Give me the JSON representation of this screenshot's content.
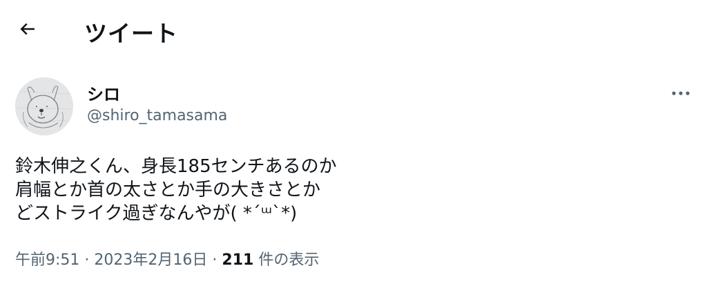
{
  "header": {
    "back_icon": "arrow-left-icon",
    "title": "ツイート"
  },
  "author": {
    "avatar_icon": "dog-sketch-avatar",
    "display_name": "シロ",
    "handle": "@shiro_tamasama"
  },
  "more_icon": "more-horizontal-icon",
  "tweet": {
    "lines": [
      "鈴木伸之くん、身長185センチあるのか",
      "肩幅とか首の太さとか手の大きさとか",
      "どストライク過ぎなんやが( *´ᵚ`*)"
    ]
  },
  "meta": {
    "time": "午前9:51",
    "separator": "·",
    "date": "2023年2月16日",
    "views_count": "211",
    "views_label": "件の表示"
  },
  "colors": {
    "text_primary": "#0f1419",
    "text_secondary": "#536471",
    "background": "#ffffff"
  }
}
